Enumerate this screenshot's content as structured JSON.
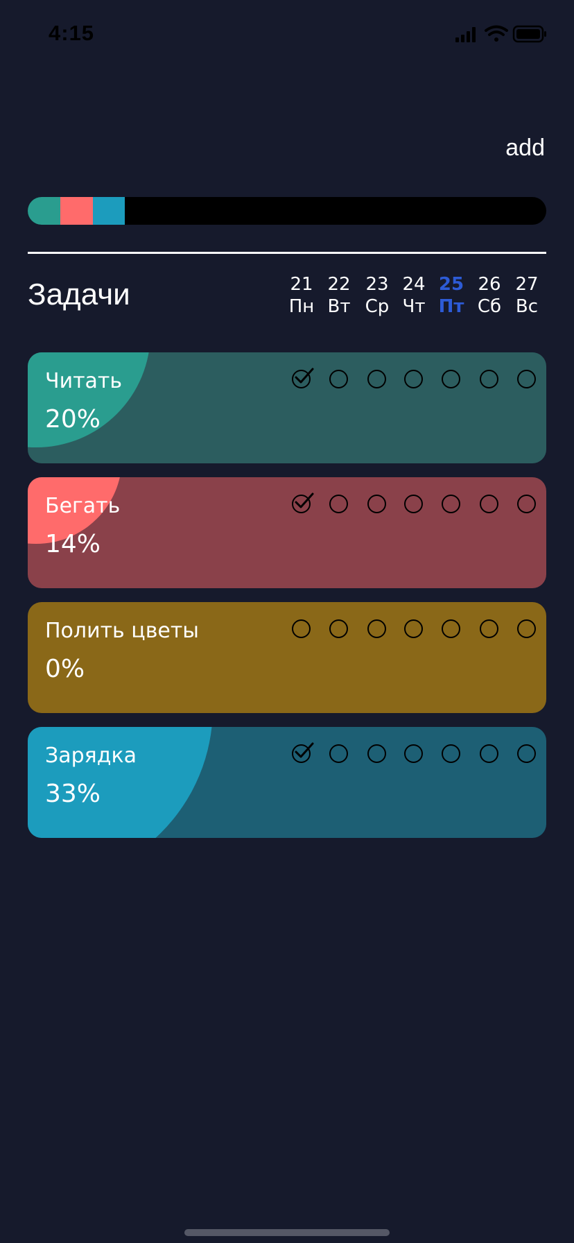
{
  "status_bar": {
    "time": "4:15",
    "icons": [
      "cellular-signal-icon",
      "wifi-icon",
      "battery-icon"
    ]
  },
  "header": {
    "add_label": "add"
  },
  "overall_progress": {
    "segments": [
      {
        "task": "Читать",
        "color": "#2a9d8f",
        "fraction": 0.0625
      },
      {
        "task": "Бегать",
        "color": "#ff6b6b",
        "fraction": 0.0625
      },
      {
        "task": "Зарядка",
        "color": "#1c9cbd",
        "fraction": 0.0625
      }
    ],
    "track_color": "#000000"
  },
  "section": {
    "title": "Задачи"
  },
  "week": {
    "today_color": "#2d5bd6",
    "days": [
      {
        "num": "21",
        "name": "Пн",
        "today": false
      },
      {
        "num": "22",
        "name": "Вт",
        "today": false
      },
      {
        "num": "23",
        "name": "Ср",
        "today": false
      },
      {
        "num": "24",
        "name": "Чт",
        "today": false
      },
      {
        "num": "25",
        "name": "Пт",
        "today": true
      },
      {
        "num": "26",
        "name": "Сб",
        "today": false
      },
      {
        "num": "27",
        "name": "Вс",
        "today": false
      }
    ]
  },
  "tasks": [
    {
      "name": "Читать",
      "percent": "20%",
      "progress": 0.2,
      "card_color": "#2c5d5f",
      "accent_color": "#2a9d8f",
      "checks": [
        true,
        false,
        false,
        false,
        false,
        false,
        false
      ]
    },
    {
      "name": "Бегать",
      "percent": "14%",
      "progress": 0.14,
      "card_color": "#8a414a",
      "accent_color": "#ff6b6b",
      "checks": [
        true,
        false,
        false,
        false,
        false,
        false,
        false
      ]
    },
    {
      "name": "Полить цветы",
      "percent": "0%",
      "progress": 0.0,
      "card_color": "#8a6818",
      "accent_color": "#d9a21a",
      "checks": [
        false,
        false,
        false,
        false,
        false,
        false,
        false
      ]
    },
    {
      "name": "Зарядка",
      "percent": "33%",
      "progress": 0.33,
      "card_color": "#1d5f74",
      "accent_color": "#1c9cbd",
      "checks": [
        true,
        false,
        false,
        false,
        false,
        false,
        false
      ]
    }
  ]
}
